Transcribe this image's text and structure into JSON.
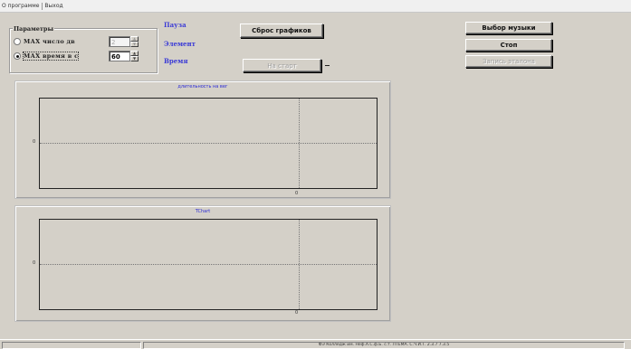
{
  "menu": {
    "items": [
      "О программе",
      "Выход"
    ]
  },
  "params": {
    "group_title": "Параметры",
    "option_count_label": "МАХ   число  дв",
    "option_time_label": "МАХ  время  в  с",
    "count_value": "2",
    "time_value": "60",
    "selected": "time"
  },
  "labels": {
    "pause": "Пауза",
    "element": "Элемент",
    "time": "Время"
  },
  "buttons": {
    "reset_charts": "Сброс графиков",
    "to_start": "На старт",
    "choose_music": "Выбор музыки",
    "stop": "Стоп",
    "record_reference": "Запись эталона"
  },
  "chart_data": [
    {
      "type": "line",
      "title": "длительность на вег",
      "ytick": "0",
      "xtick": "0",
      "series": [],
      "grid": true
    },
    {
      "type": "line",
      "title": "TChart",
      "ytick": "0",
      "xtick": "0",
      "series": [],
      "grid": true
    }
  ],
  "status": {
    "left": "",
    "right": "ФЭ Колледж им. Неф.А.С.ф.Б. с.т. ЛТЕМА. С.Ч.И.Т. 2.3.7 7.3.5"
  }
}
